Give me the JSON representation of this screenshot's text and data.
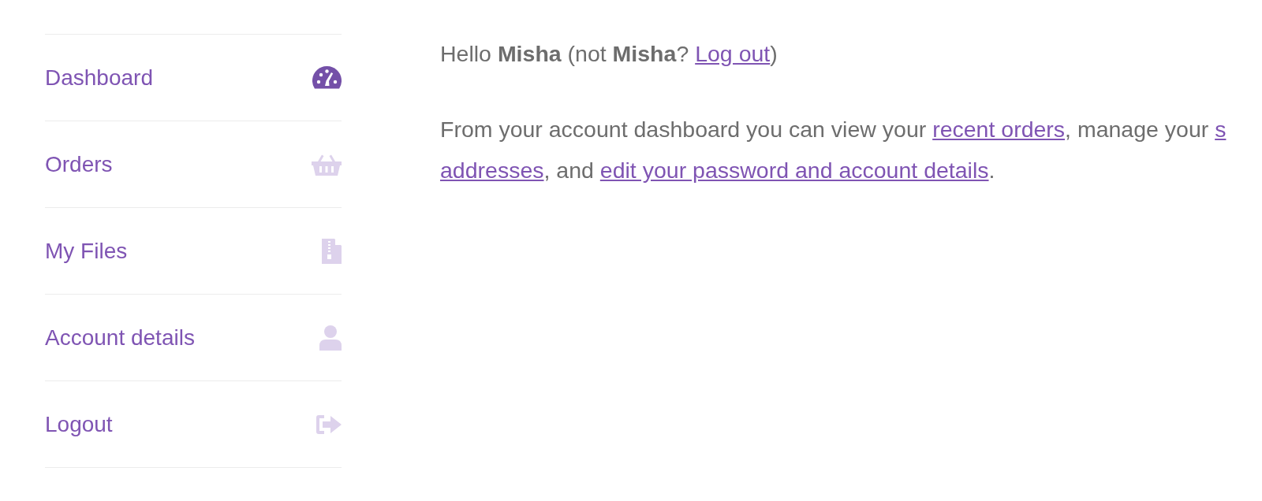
{
  "sidebar": {
    "items": [
      {
        "label": "Dashboard",
        "selected": true
      },
      {
        "label": "Orders",
        "selected": false
      },
      {
        "label": "My Files",
        "selected": false
      },
      {
        "label": "Account details",
        "selected": false
      },
      {
        "label": "Logout",
        "selected": false
      }
    ]
  },
  "content": {
    "greeting": [
      {
        "kind": "text",
        "text": "Hello **Misha** (not **Misha**? "
      },
      {
        "kind": "link",
        "text": "Log out"
      },
      {
        "kind": "text",
        "text": ")"
      }
    ],
    "intro": {
      "lines": [
        [
          {
            "kind": "text",
            "text": "From your account dashboard you can view your "
          },
          {
            "kind": "link",
            "text": "recent orders"
          },
          {
            "kind": "text",
            "text": ", manage your "
          },
          {
            "kind": "link",
            "text": "s"
          }
        ],
        [
          {
            "kind": "link",
            "text": "addresses"
          },
          {
            "kind": "text",
            "text": ", and "
          },
          {
            "kind": "link",
            "text": "edit your password and account details"
          },
          {
            "kind": "text",
            "text": "."
          }
        ]
      ]
    }
  }
}
